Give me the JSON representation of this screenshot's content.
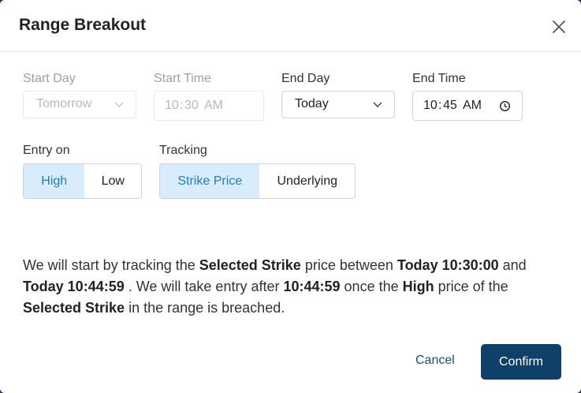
{
  "dialog": {
    "title": "Range Breakout"
  },
  "fields": {
    "start_day": {
      "label": "Start Day",
      "value": "Tomorrow"
    },
    "start_time": {
      "label": "Start Time",
      "hour": "10",
      "minute": "30",
      "ampm": "AM"
    },
    "end_day": {
      "label": "End Day",
      "value": "Today"
    },
    "end_time": {
      "label": "End Time",
      "hour": "10",
      "minute": "45",
      "ampm": "AM"
    }
  },
  "entry_on": {
    "label": "Entry on",
    "options": [
      "High",
      "Low"
    ],
    "selected": "High"
  },
  "tracking": {
    "label": "Tracking",
    "options": [
      "Strike Price",
      "Underlying"
    ],
    "selected": "Strike Price"
  },
  "summary": {
    "t1": "We will start by tracking the ",
    "b1": "Selected Strike",
    "t2": " price between ",
    "b2": "Today 10:30:00",
    "t3": " and ",
    "b3": "Today 10:44:59",
    "t4": " . We will take entry after ",
    "b4": "10:44:59",
    "t5": " once the ",
    "b5": "High",
    "t6": " price of the ",
    "b6": "Selected Strike",
    "t7": " in the range is breached."
  },
  "actions": {
    "cancel": "Cancel",
    "confirm": "Confirm"
  },
  "icons": {
    "close": "close-icon",
    "dropdown": "chevron-down-icon",
    "clock": "clock-icon"
  },
  "colors": {
    "accent": "#1b7fc4",
    "accent_bg": "#d9ecfc",
    "primary_button": "#0e4068",
    "cancel_text": "#1d4e79"
  }
}
